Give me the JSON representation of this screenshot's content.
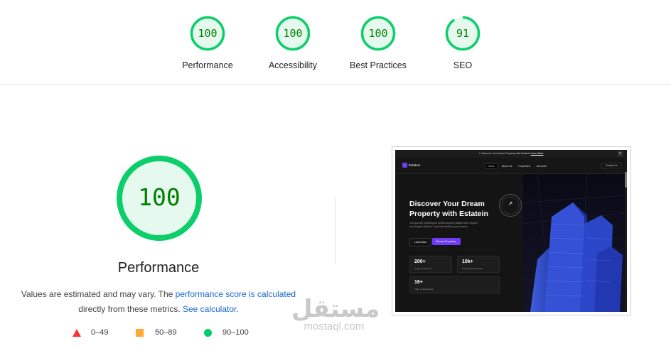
{
  "gauges": [
    {
      "label": "Performance",
      "score": "100",
      "fraction": 1.0
    },
    {
      "label": "Accessibility",
      "score": "100",
      "fraction": 1.0
    },
    {
      "label": "Best Practices",
      "score": "100",
      "fraction": 1.0
    },
    {
      "label": "SEO",
      "score": "91",
      "fraction": 0.91
    }
  ],
  "main": {
    "score": "100",
    "fraction": 1.0,
    "title": "Performance",
    "desc_prefix": "Values are estimated and may vary. The ",
    "desc_link1": "performance score is calculated",
    "desc_middle": " directly from these metrics. ",
    "desc_link2": "See calculator",
    "desc_suffix": "."
  },
  "legend": [
    {
      "shape": "triangle",
      "color": "#ff3333",
      "range": "0–49"
    },
    {
      "shape": "square",
      "color": "#ffaa33",
      "range": "50–89"
    },
    {
      "shape": "circle",
      "color": "#00cc66",
      "range": "90–100"
    }
  ],
  "colors": {
    "pass": "#0cce6b",
    "pass_text": "#008000",
    "pass_fill": "#e6f9ee",
    "accent_purple": "#703bf7"
  },
  "screenshot": {
    "promo_text": "✦ Discover Your Dream Property with Estatein",
    "promo_link": "Learn More",
    "promo_close": "✕",
    "logo": "Estatein",
    "nav": [
      "Home",
      "About Us",
      "Properties",
      "Services"
    ],
    "contact": "Contact Us",
    "hero_title": "Discover Your Dream Property with Estatein",
    "hero_sub": "Your journey to finding the perfect property begins here. Explore our listings to find the home that matches your dreams.",
    "btn_learn": "Learn More",
    "btn_browse": "Browse Properties",
    "stats": [
      {
        "value": "200+",
        "label": "Happy Customers"
      },
      {
        "value": "10k+",
        "label": "Properties For Clients"
      },
      {
        "value": "16+",
        "label": "Years of Experience"
      }
    ],
    "badge_arrow": "↗"
  },
  "watermark": {
    "arabic": "مستقل",
    "latin": "mostaql.com"
  }
}
